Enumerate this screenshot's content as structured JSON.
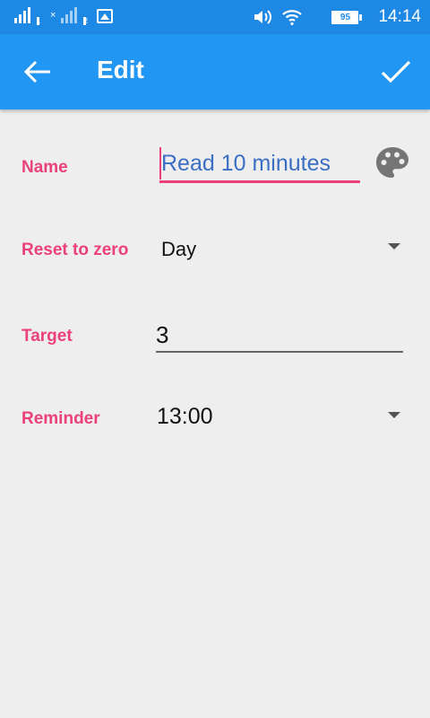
{
  "status_bar": {
    "sim1_label": "1",
    "sim2_label": "2",
    "battery": "95",
    "time": "14:14"
  },
  "app_bar": {
    "title": "Edit",
    "back_icon": "arrow-back-icon",
    "confirm_icon": "checkmark-icon"
  },
  "form": {
    "name_label": "Name",
    "name_value": "Read 10 minutes",
    "reset_label": "Reset to zero",
    "reset_value": "Day",
    "target_label": "Target",
    "target_value": "3",
    "reminder_label": "Reminder",
    "reminder_value": "13:00"
  },
  "colors": {
    "appbar": "#2196f3",
    "statusbar": "#1e88e5",
    "accent": "#ec407a",
    "background": "#eeeeee"
  }
}
